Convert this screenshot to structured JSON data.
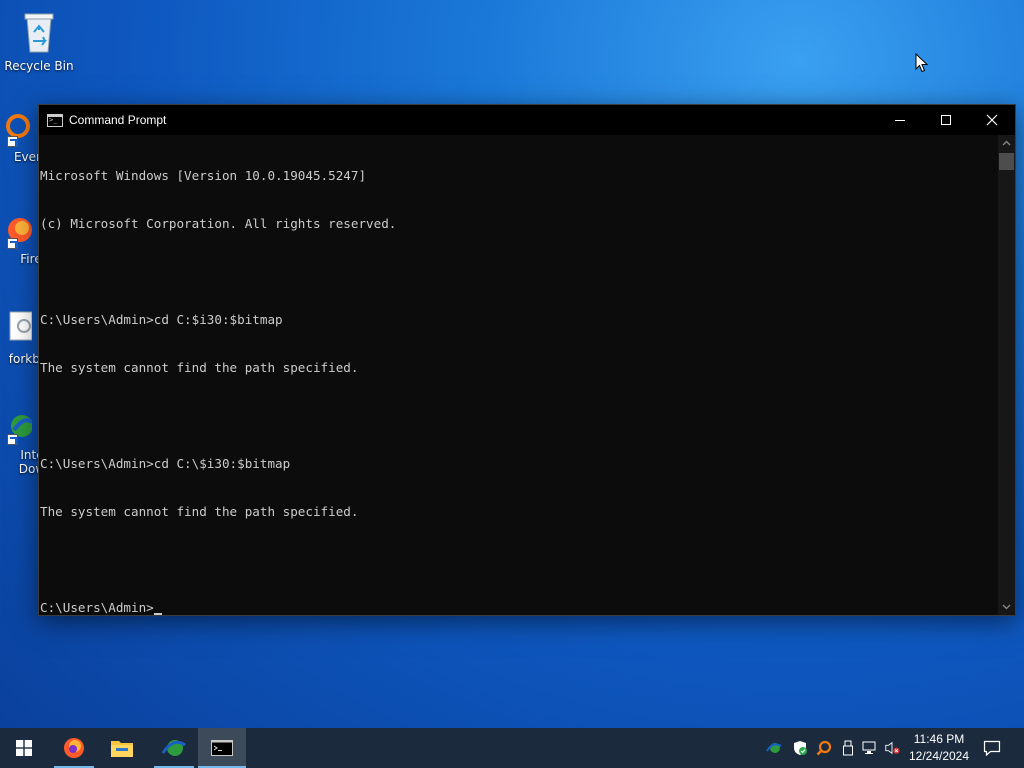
{
  "desktop": {
    "icons": [
      {
        "label": "Recycle Bin"
      },
      {
        "label": "Every"
      },
      {
        "label": "Fire"
      },
      {
        "label": "forkbo"
      },
      {
        "label": "Inte"
      },
      {
        "label": "Dow"
      }
    ]
  },
  "window": {
    "title": "Command Prompt",
    "console_lines": [
      "Microsoft Windows [Version 10.0.19045.5247]",
      "(c) Microsoft Corporation. All rights reserved.",
      "",
      "C:\\Users\\Admin>cd C:$i30:$bitmap",
      "The system cannot find the path specified.",
      "",
      "C:\\Users\\Admin>cd C:\\$i30:$bitmap",
      "The system cannot find the path specified.",
      "",
      "C:\\Users\\Admin>"
    ]
  },
  "taskbar": {
    "clock_time": "11:46 PM",
    "clock_date": "12/24/2024"
  },
  "colors": {
    "console_bg": "#0c0c0c",
    "console_text": "#cccccc",
    "taskbar_bg": "#1b2b3d",
    "accent": "#76b9ed"
  }
}
